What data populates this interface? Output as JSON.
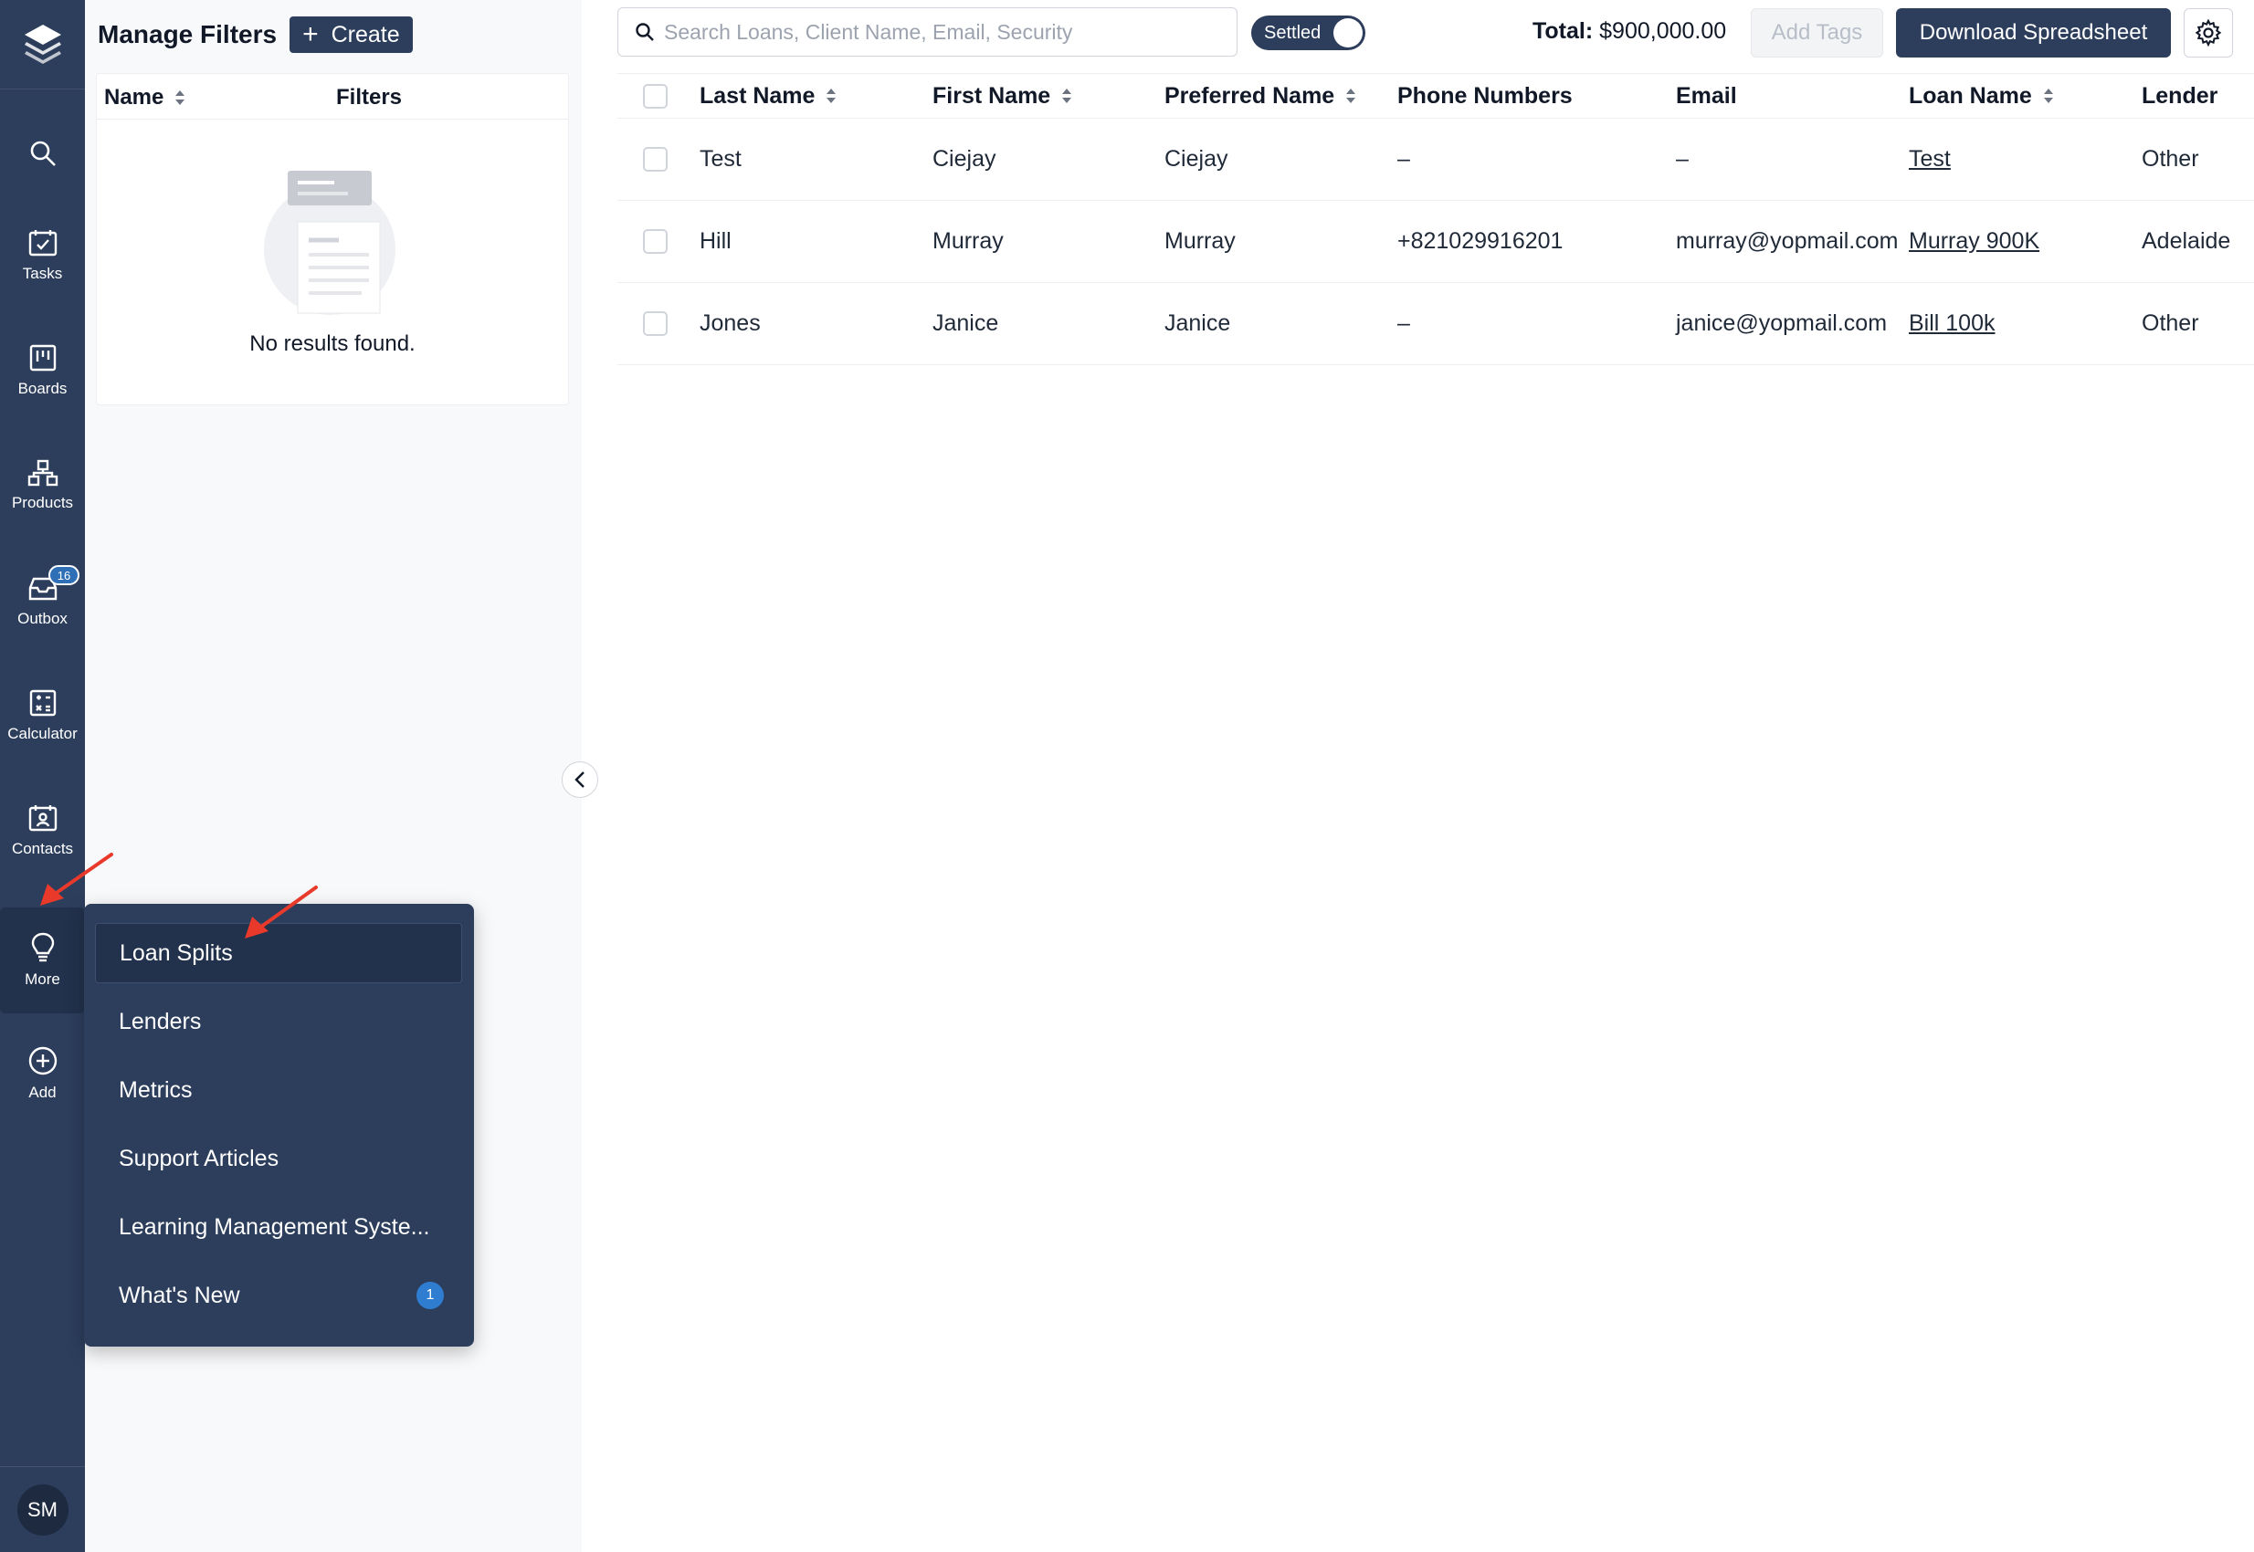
{
  "nav": {
    "items": [
      {
        "label": "",
        "icon": "search-icon"
      },
      {
        "label": "Tasks",
        "icon": "tasks-icon"
      },
      {
        "label": "Boards",
        "icon": "boards-icon"
      },
      {
        "label": "Products",
        "icon": "products-icon"
      },
      {
        "label": "Outbox",
        "icon": "outbox-icon",
        "badge": "16"
      },
      {
        "label": "Calculator",
        "icon": "calculator-icon"
      },
      {
        "label": "Contacts",
        "icon": "contacts-icon"
      },
      {
        "label": "More",
        "icon": "lightbulb-icon"
      },
      {
        "label": "Add",
        "icon": "plus-circle-icon"
      }
    ],
    "avatar_initials": "SM"
  },
  "filters_panel": {
    "title": "Manage Filters",
    "create_label": "Create",
    "columns": {
      "name": "Name",
      "filters": "Filters"
    },
    "empty_text": "No results found."
  },
  "toolbar": {
    "search_placeholder": "Search Loans, Client Name, Email, Security",
    "toggle_label": "Settled",
    "toggle_on": true,
    "total_label": "Total:",
    "total_value": "$900,000.00",
    "add_tags_label": "Add Tags",
    "download_label": "Download Spreadsheet"
  },
  "table": {
    "headers": [
      "Last Name",
      "First Name",
      "Preferred Name",
      "Phone Numbers",
      "Email",
      "Loan Name",
      "Lender"
    ],
    "rows": [
      {
        "last": "Test",
        "first": "Ciejay",
        "preferred": "Ciejay",
        "phone": "–",
        "email": "–",
        "loan": "Test",
        "lender": "Other"
      },
      {
        "last": "Hill",
        "first": "Murray",
        "preferred": "Murray",
        "phone": "+821029916201",
        "email": "murray@yopmail.com",
        "loan": "Murray 900K",
        "lender": "Adelaide"
      },
      {
        "last": "Jones",
        "first": "Janice",
        "preferred": "Janice",
        "phone": "–",
        "email": "janice@yopmail.com",
        "loan": "Bill 100k",
        "lender": "Other"
      }
    ]
  },
  "more_menu": {
    "items": [
      {
        "label": "Loan Splits"
      },
      {
        "label": "Lenders"
      },
      {
        "label": "Metrics"
      },
      {
        "label": "Support Articles"
      },
      {
        "label": "Learning Management Syste..."
      },
      {
        "label": "What's New",
        "badge": "1"
      }
    ]
  },
  "colors": {
    "nav_bg": "#2c3e5c",
    "accent": "#2c3e5c",
    "badge": "#2f7dd0",
    "annotation_arrow": "#e8392b"
  }
}
